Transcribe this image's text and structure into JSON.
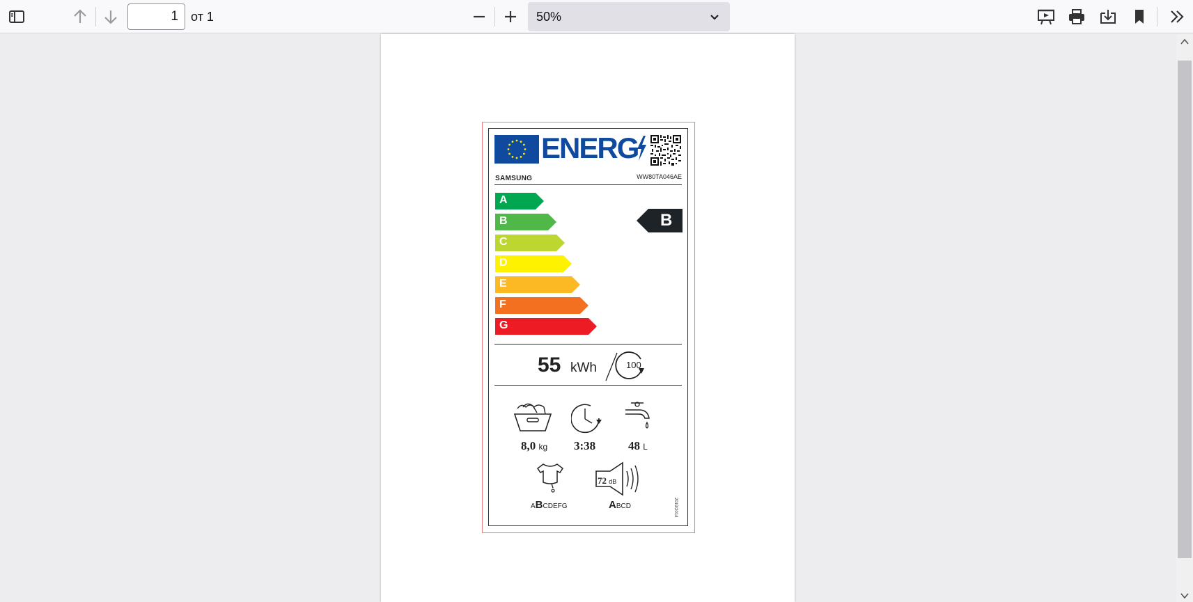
{
  "toolbar": {
    "page_current": "1",
    "page_count": "от 1",
    "zoom_value": "50%"
  },
  "label": {
    "energy_word": "ENERG",
    "brand": "SAMSUNG",
    "model": "WW80TA046AE",
    "classes": [
      "A",
      "B",
      "C",
      "D",
      "E",
      "F",
      "G"
    ],
    "class_colors": [
      "#00a650",
      "#50b848",
      "#bed630",
      "#fff200",
      "#fdb924",
      "#f37021",
      "#ed1c24"
    ],
    "rating": "B",
    "energy_value": "55",
    "energy_unit": "kWh",
    "cycles": "100",
    "capacity_value": "8,0",
    "capacity_unit": "kg",
    "duration_value": "3:38",
    "water_value": "48",
    "water_unit": "L",
    "spin_class_small": "A",
    "spin_class_big": "B",
    "spin_class_rest": "CDEFG",
    "noise_value": "72",
    "noise_unit": "dB",
    "noise_class_big": "A",
    "noise_class_rest": "BCD",
    "regulation": "2019/2014"
  }
}
